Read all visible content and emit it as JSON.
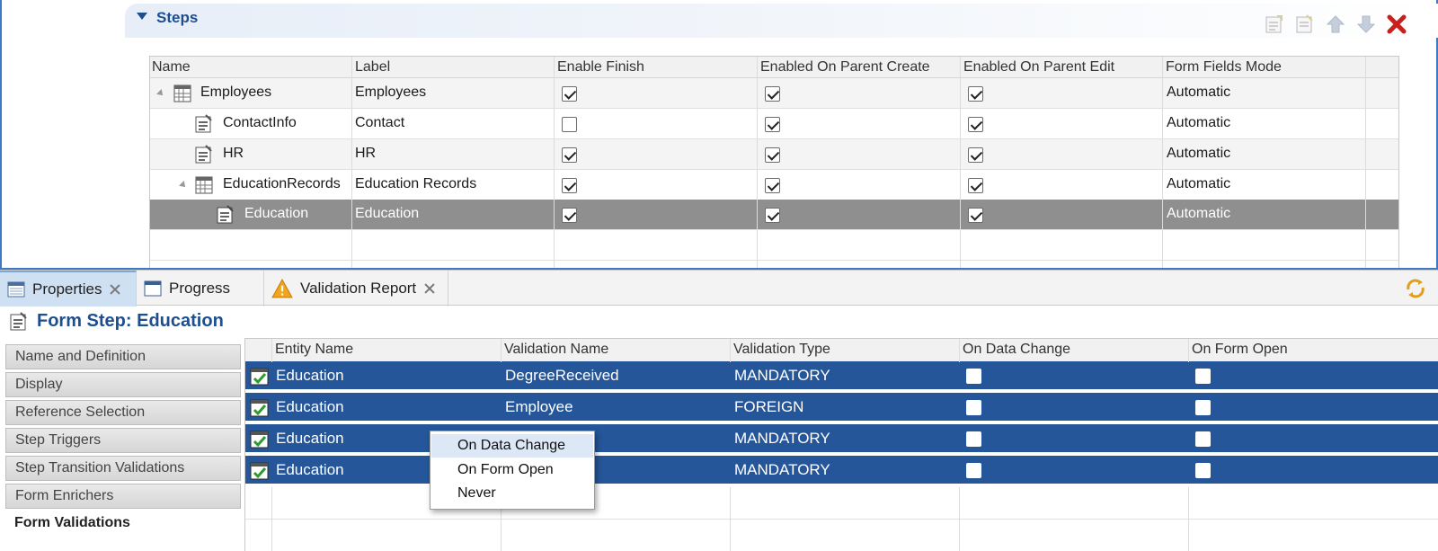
{
  "steps_section": {
    "title": "Steps",
    "toolbar": [
      "add-form-step-icon",
      "add-step-icon",
      "move-up-icon",
      "move-down-icon",
      "delete-icon"
    ],
    "columns": [
      "Name",
      "Label",
      "Enable Finish",
      "Enabled On Parent Create",
      "Enabled On Parent Edit",
      "Form Fields Mode"
    ],
    "rows": [
      {
        "name": "Employees",
        "label": "Employees",
        "enable_finish": true,
        "parent_create": true,
        "parent_edit": true,
        "mode": "Automatic"
      },
      {
        "name": "ContactInfo",
        "label": "Contact",
        "enable_finish": false,
        "parent_create": true,
        "parent_edit": true,
        "mode": "Automatic"
      },
      {
        "name": "HR",
        "label": "HR",
        "enable_finish": true,
        "parent_create": true,
        "parent_edit": true,
        "mode": "Automatic"
      },
      {
        "name": "EducationRecords",
        "label": "Education Records",
        "enable_finish": true,
        "parent_create": true,
        "parent_edit": true,
        "mode": "Automatic"
      },
      {
        "name": "Education",
        "label": "Education",
        "enable_finish": true,
        "parent_create": true,
        "parent_edit": true,
        "mode": "Automatic"
      }
    ]
  },
  "view_tabs": [
    {
      "label": "Properties",
      "icon": "properties-icon",
      "active": true
    },
    {
      "label": "Progress",
      "icon": "progress-icon",
      "active": false
    },
    {
      "label": "Validation Report",
      "icon": "warning-icon",
      "active": false
    }
  ],
  "properties": {
    "title": "Form Step: Education",
    "side_tabs": [
      "Name and Definition",
      "Display",
      "Reference Selection",
      "Step Triggers",
      "Step Transition Validations",
      "Form Enrichers",
      "Form Validations"
    ],
    "active_side_tab": "Form Validations"
  },
  "validations": {
    "columns": [
      "Entity Name",
      "Validation Name",
      "Validation Type",
      "On Data Change",
      "On Form Open"
    ],
    "rows": [
      {
        "entity": "Education",
        "name": "DegreeReceived",
        "type": "MANDATORY",
        "on_change": false,
        "on_open": false
      },
      {
        "entity": "Education",
        "name": "Employee",
        "type": "FOREIGN",
        "on_change": false,
        "on_open": false
      },
      {
        "entity": "Education",
        "name": "",
        "type": "MANDATORY",
        "on_change": false,
        "on_open": false
      },
      {
        "entity": "Education",
        "name": "",
        "type": "MANDATORY",
        "on_change": false,
        "on_open": false
      }
    ]
  },
  "context_menu": {
    "items": [
      "On Data Change",
      "On Form Open",
      "Never"
    ],
    "highlighted": "On Data Change"
  },
  "colors": {
    "accent_blue": "#1d4e8f",
    "selection_blue": "#25569a",
    "selected_gray": "#8f8f8f"
  }
}
